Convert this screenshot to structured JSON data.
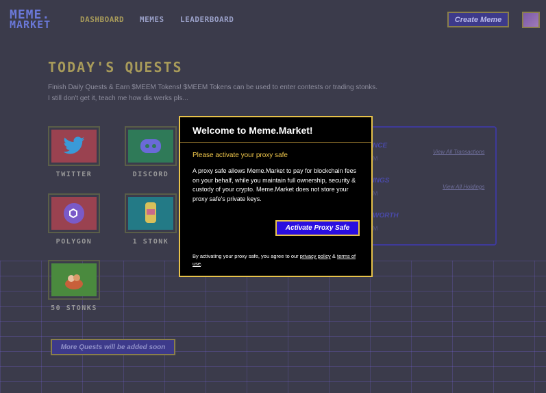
{
  "header": {
    "logo_line1": "MEME.",
    "logo_line2": "MARKET",
    "nav": [
      "DASHBOARD",
      "MEMES",
      "LEADERBOARD"
    ],
    "create_button": "Create Meme"
  },
  "page": {
    "title": "TODAY'S QUESTS",
    "description_line1": "Finish Daily Quests & Earn $MEEM Tokens! $MEEM Tokens can be used to enter contests or trading stonks.",
    "description_line2": "I still don't get it, teach me how dis werks pls...",
    "more_quests_button": "More Quests will be added soon"
  },
  "quests": [
    {
      "label": "TWITTER",
      "icon": "twitter-bird-icon",
      "color": "#c44a5a"
    },
    {
      "label": "DISCORD",
      "icon": "discord-icon",
      "color": "#3a9a6a"
    },
    {
      "label": "POLYGON",
      "icon": "polygon-icon",
      "color": "#c44a5a"
    },
    {
      "label": "1 STONK",
      "icon": "stonk-icon",
      "color": "#2a9aa8"
    },
    {
      "label": "50 STONKS",
      "icon": "stonks-bowl-icon",
      "color": "#5aa84a"
    }
  ],
  "summary": {
    "labels": [
      "NCE",
      "INGS",
      "WORTH"
    ],
    "values": [
      "M",
      "M",
      "M"
    ],
    "links": [
      "View All Transactions",
      "View All Holdings"
    ]
  },
  "modal": {
    "title": "Welcome to Meme.Market!",
    "subtitle": "Please activate your proxy safe",
    "body": "A proxy safe allows Meme.Market to pay for blockchain fees on your behalf, while you maintain full ownership, security & custody of your crypto. Meme.Market does not store your proxy safe's private keys.",
    "activate_button": "Activate Proxy Safe",
    "footer_prefix": "By activating your proxy safe, you agree to our",
    "footer_privacy": "privacy policy",
    "footer_and": "&",
    "footer_terms": "terms of use",
    "footer_suffix": "."
  },
  "colors": {
    "accent_gold": "#e8c34a",
    "primary_blue": "#2a0ee0",
    "background": "#3b3b4b"
  }
}
